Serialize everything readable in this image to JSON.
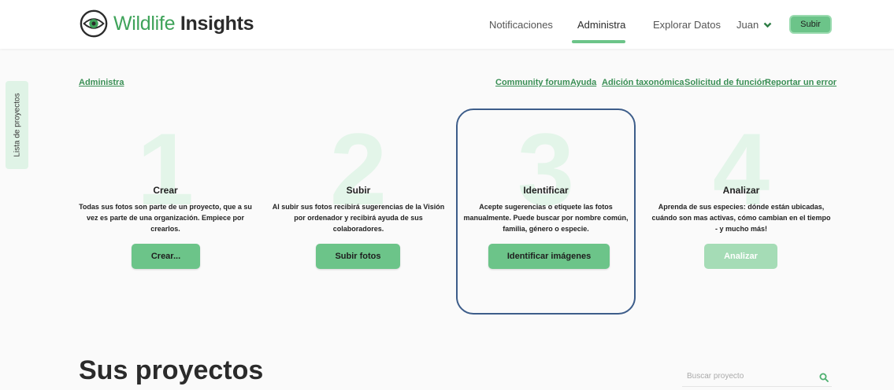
{
  "header": {
    "logo_word1": "Wildlife",
    "logo_word2": "Insights",
    "nav": [
      "Notificaciones",
      "Administra",
      "Explorar Datos"
    ],
    "user_name": "Juan",
    "upload_label": "Subir"
  },
  "sidebar_tab": "Lista de proyectos",
  "breadcrumb": "Administra",
  "links": [
    "Community forum",
    "Ayuda",
    "Adición taxonómica",
    "Solicitud de función",
    "Reportar un error"
  ],
  "steps": [
    {
      "number": "1",
      "title": "Crear",
      "desc": "Todas sus fotos son parte de un proyecto, que a su vez es parte de una organización. Empiece por crearlos.",
      "button": "Crear..."
    },
    {
      "number": "2",
      "title": "Subir",
      "desc": "Al subir sus fotos recibirá sugerencias de la Visión por ordenador y recibirá ayuda de sus colaboradores.",
      "button": "Subir fotos"
    },
    {
      "number": "3",
      "title": "Identificar",
      "desc": "Acepte sugerencias o etiquete las fotos manualmente. Puede buscar por nombre común, familia, género o especie.",
      "button": "Identificar imágenes"
    },
    {
      "number": "4",
      "title": "Analizar",
      "desc": "Aprenda de sus especies: dónde están ubicadas, cuándo son mas activas, cómo cambian en el tiempo - y mucho más!",
      "button": "Analizar"
    }
  ],
  "projects_title": "Sus proyectos",
  "search": {
    "placeholder": "Buscar proyecto"
  },
  "colors": {
    "accent": "#6cc489",
    "link": "#3a8f55",
    "highlight": "#3d5d8a"
  }
}
